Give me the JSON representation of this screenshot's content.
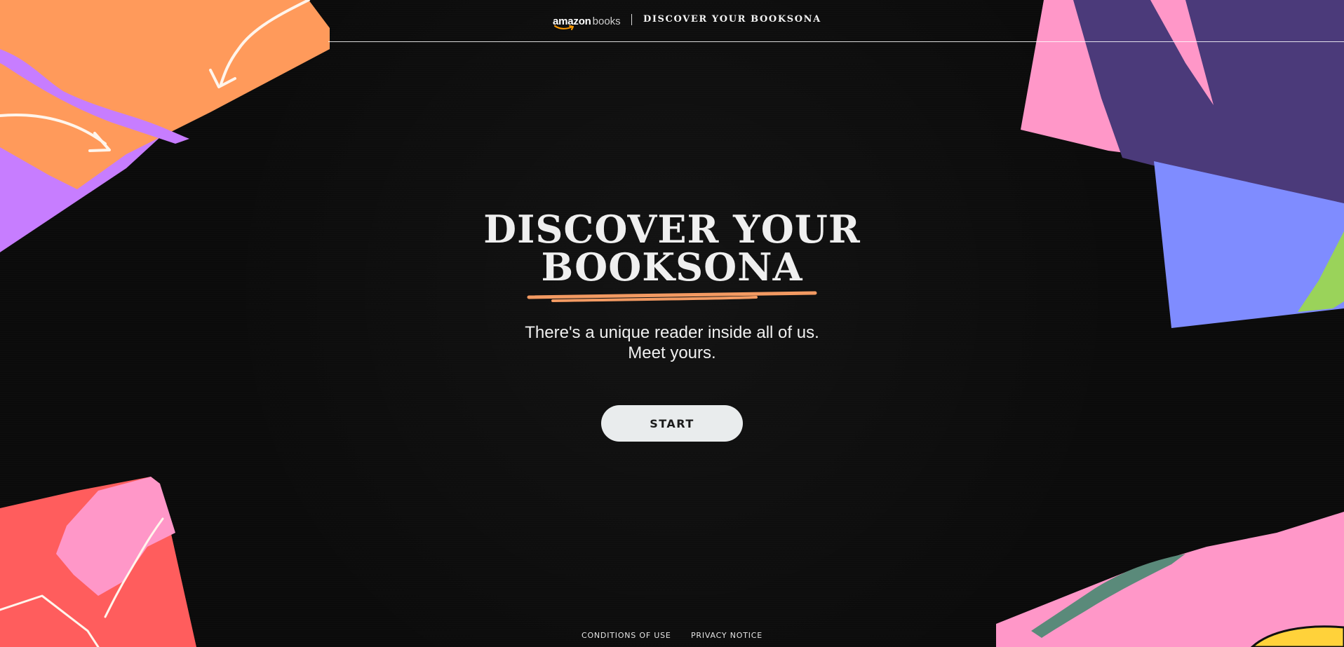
{
  "header": {
    "brand_amazon": "amazon",
    "brand_books": "books",
    "title": "DISCOVER YOUR BOOKSONA"
  },
  "hero": {
    "headline_line1": "DISCOVER YOUR",
    "headline_line2": "BOOKSONA",
    "subtitle_line1": "There's a unique reader inside all of us.",
    "subtitle_line2": "Meet yours.",
    "start_label": "START"
  },
  "footer": {
    "conditions_label": "CONDITIONS OF USE",
    "privacy_label": "PRIVACY NOTICE"
  },
  "colors": {
    "background": "#0b0b0b",
    "orange": "#ff9a5b",
    "purple": "#c77dff",
    "pink": "#ff97c8",
    "indigo": "#4b3a7a",
    "periwinkle": "#7f8cff",
    "lime": "#9ad35a",
    "coral": "#ff5d5d",
    "green": "#5a8a7a",
    "yellow": "#ffd23a",
    "button": "#e9eced",
    "underline": "#f39a62"
  },
  "icons": [
    "amazon-smile-icon",
    "arrow-doodle-icon"
  ]
}
